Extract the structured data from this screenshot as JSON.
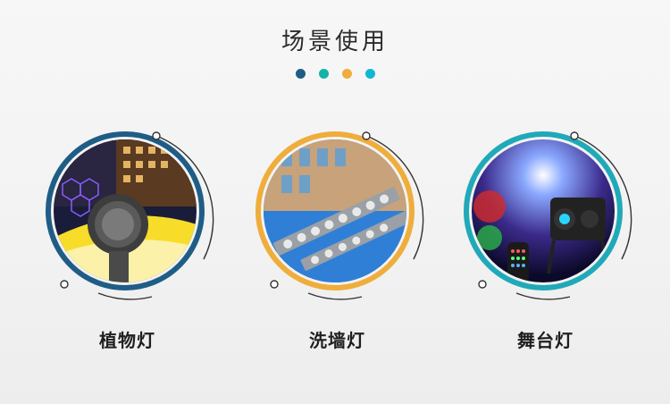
{
  "header": {
    "title": "场景使用",
    "dot_colors": [
      "#1f5d86",
      "#13b4a5",
      "#efad3b",
      "#13b6d2"
    ]
  },
  "scenes": [
    {
      "label": "植物灯",
      "ring_color": "#1f5d86",
      "icon": "spotlight-photo"
    },
    {
      "label": "洗墙灯",
      "ring_color": "#efad3b",
      "icon": "wall-washer-photo"
    },
    {
      "label": "舞台灯",
      "ring_color": "#20a9b8",
      "icon": "stage-light-photo"
    }
  ]
}
